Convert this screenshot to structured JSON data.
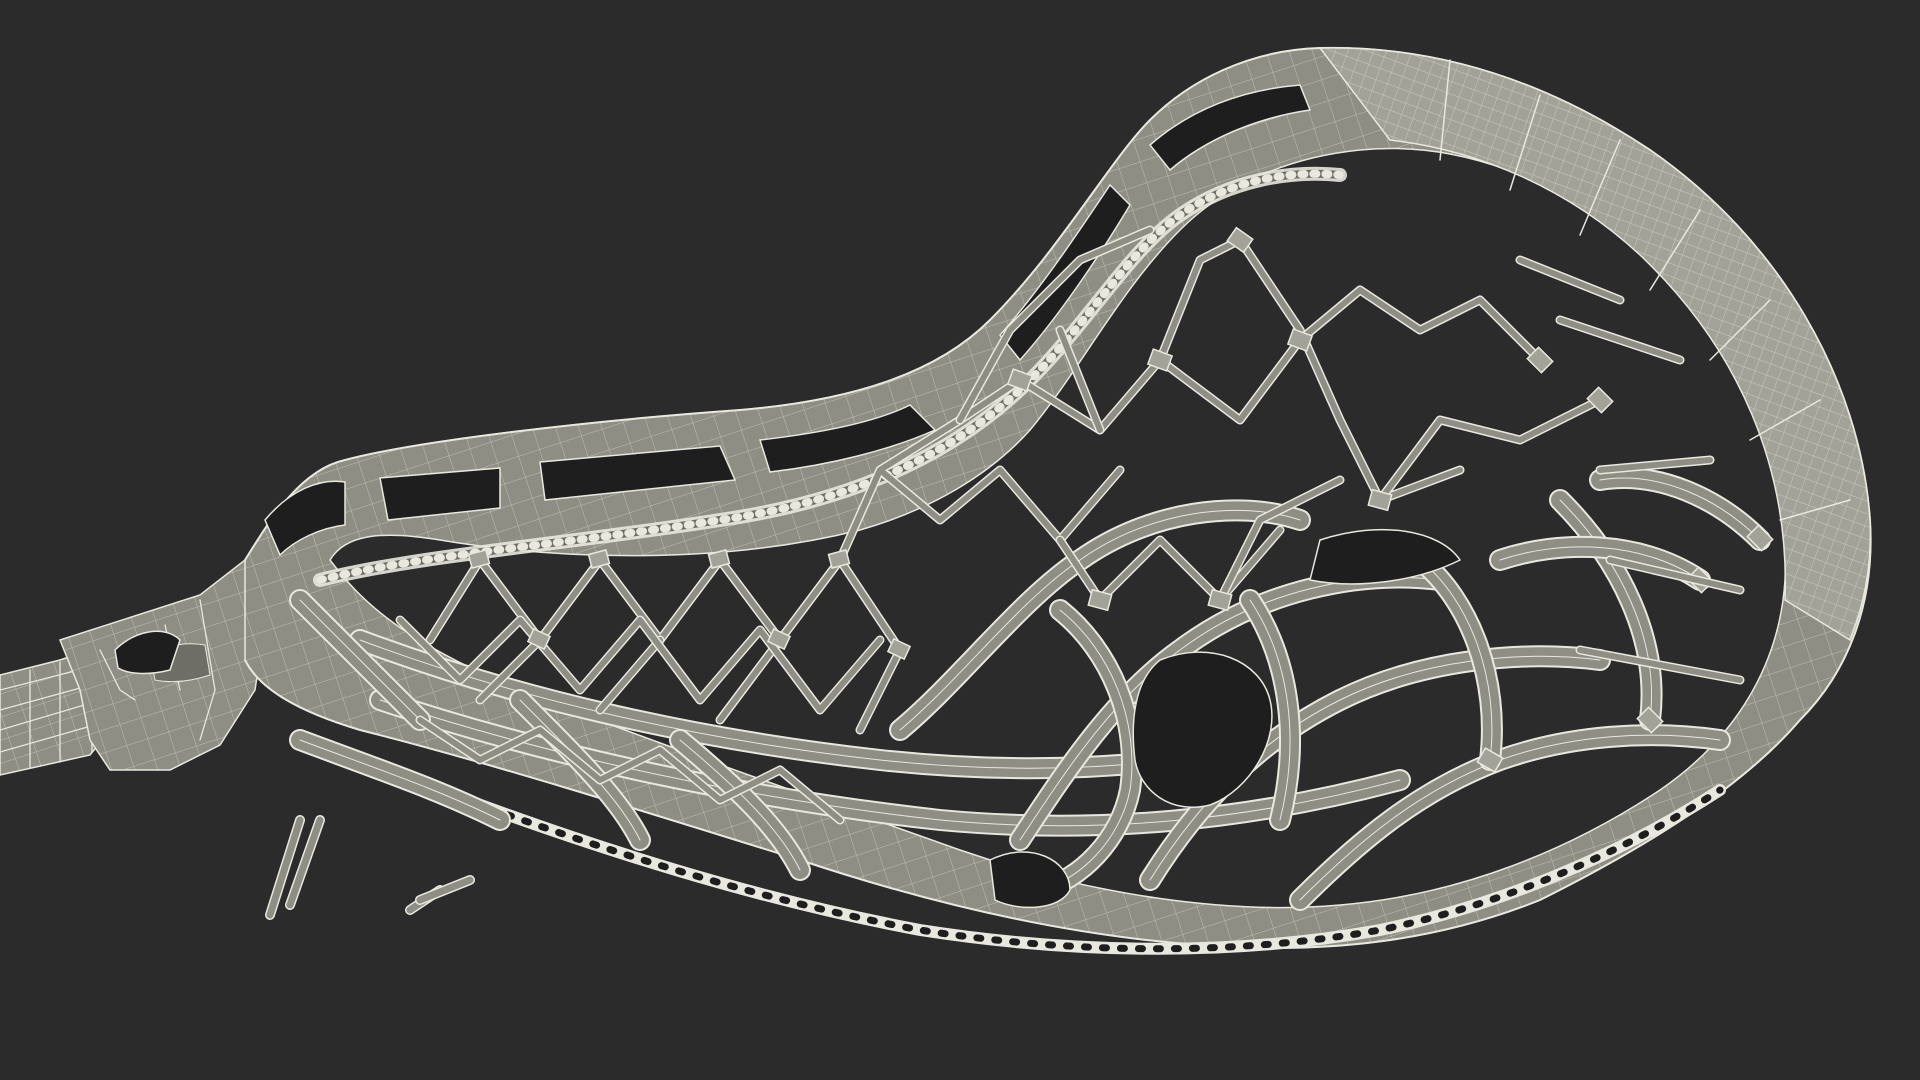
{
  "scene": {
    "subject_icon": "lacrosse-head-wireframe-icon",
    "colors": {
      "background": "#2b2b2b",
      "surface": "#8f8e84",
      "surface_light": "#a3a298",
      "surface_dark": "#6f6e66",
      "wire": "#e9e8df",
      "shadow": "#1e1e1e"
    }
  }
}
